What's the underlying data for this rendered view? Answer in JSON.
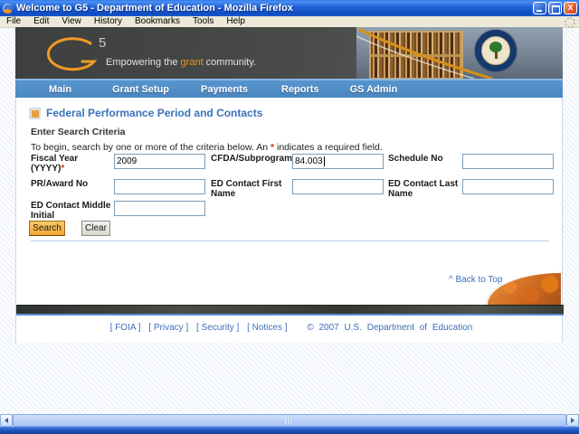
{
  "window": {
    "title": "Welcome to G5 - Department of Education - Mozilla Firefox",
    "close_glyph": "x"
  },
  "menubar": {
    "items": [
      "File",
      "Edit",
      "View",
      "History",
      "Bookmarks",
      "Tools",
      "Help"
    ]
  },
  "banner": {
    "logo_sup": "5",
    "slogan_pre": "Empowering the ",
    "slogan_highlight": "grant",
    "slogan_post": " community."
  },
  "nav": {
    "items": [
      "Main",
      "Grant Setup",
      "Payments",
      "Reports",
      "GS Admin"
    ]
  },
  "page": {
    "title": "Federal Performance Period and Contacts",
    "section_heading": "Enter Search Criteria",
    "instructions_pre": "To begin, search by one or more of the criteria below. An ",
    "instructions_star": "*",
    "instructions_post": " indicates a required field."
  },
  "form": {
    "fields": [
      {
        "label": "Fiscal Year (YYYY)",
        "required": "*",
        "value": "2009"
      },
      {
        "label": "CFDA/Subprogram",
        "value": "84.003"
      },
      {
        "label": "Schedule No",
        "value": ""
      },
      {
        "label": "PR/Award No",
        "value": ""
      },
      {
        "label": "ED Contact First Name",
        "value": ""
      },
      {
        "label": "ED Contact Last Name",
        "value": ""
      },
      {
        "label": "ED Contact Middle Initial",
        "value": ""
      }
    ],
    "search_label": "Search",
    "clear_label": "Clear"
  },
  "back_to_top": "^ Back to Top",
  "footer": {
    "bracket_l": "[",
    "bracket_r": "]",
    "links": [
      "FOIA",
      "Privacy",
      "Security",
      "Notices"
    ],
    "copyright": "© 2007 U.S. Department of Education"
  },
  "colors": {
    "nav_blue": "#4a87c2",
    "heading_blue": "#3b72ba",
    "accent_orange": "#e8941c",
    "search_button": "#f2a832",
    "required_red": "#d03020",
    "titlebar_blue": "#1f60d6"
  }
}
